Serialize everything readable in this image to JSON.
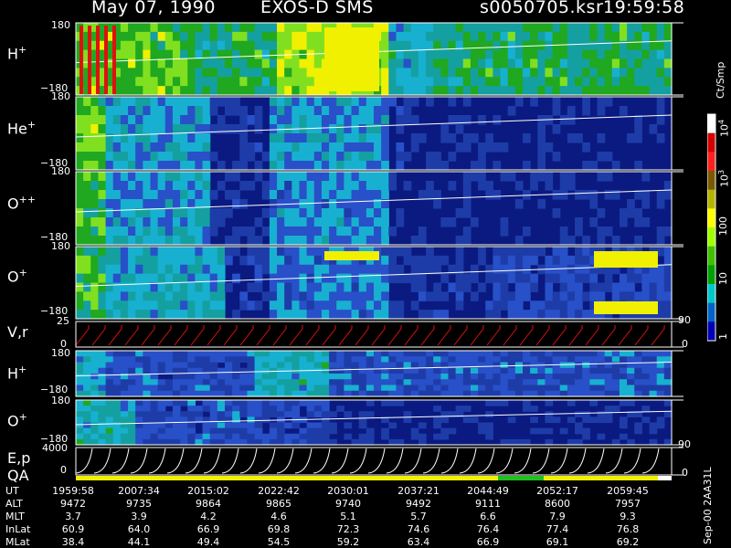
{
  "header": {
    "date": "May 07, 1990",
    "mission": "EXOS-D SMS",
    "file": "s0050705.ksr",
    "time": "19:59:58"
  },
  "colorbar": {
    "unit": "Ct/Smp",
    "ticks": [
      "10",
      "10",
      "100",
      "10",
      "1"
    ],
    "tick_exp": [
      "4",
      "3",
      "",
      "",
      ""
    ],
    "colors": [
      "#ffffff",
      "#d20000",
      "#ff2020",
      "#7a5a00",
      "#b4b400",
      "#ffff00",
      "#a0ff00",
      "#40c000",
      "#00a000",
      "#00c8c8",
      "#0064c8",
      "#0000b4"
    ]
  },
  "panels": [
    {
      "id": "h-plus",
      "label": "H",
      "sup": "+",
      "ymax": "180",
      "ymin": "−180"
    },
    {
      "id": "he-plus",
      "label": "He",
      "sup": "+",
      "ymax": "180",
      "ymin": "−180"
    },
    {
      "id": "o-plus-plus",
      "label": "O",
      "sup": "++",
      "ymax": "180",
      "ymin": "−180"
    },
    {
      "id": "o-plus",
      "label": "O",
      "sup": "+",
      "ymax": "180",
      "ymin": "−180"
    },
    {
      "id": "vr",
      "label": "V,r",
      "ymax": "25",
      "ymin": "0",
      "right_max": "90",
      "right_min": "0"
    },
    {
      "id": "h-plus-2",
      "label": "H",
      "sup": "+",
      "ymax": "180",
      "ymin": "−180"
    },
    {
      "id": "o-plus-2",
      "label": "O",
      "sup": "+",
      "ymax": "180",
      "ymin": "−180"
    },
    {
      "id": "ep",
      "label": "E,p",
      "ymax": "4000",
      "ymin": "0",
      "right_max": "90",
      "right_min": "0"
    },
    {
      "id": "qa",
      "label": "QA"
    }
  ],
  "table": {
    "rows": [
      {
        "name": "UT",
        "values": [
          "1959:58",
          "2007:34",
          "2015:02",
          "2022:42",
          "2030:01",
          "2037:21",
          "2044:49",
          "2052:17",
          "2059:45"
        ]
      },
      {
        "name": "ALT",
        "values": [
          "9472",
          "9735",
          "9864",
          "9865",
          "9740",
          "9492",
          "9111",
          "8600",
          "7957"
        ]
      },
      {
        "name": "MLT",
        "values": [
          "3.7",
          "3.9",
          "4.2",
          "4.6",
          "5.1",
          "5.7",
          "6.6",
          "7.9",
          "9.3"
        ]
      },
      {
        "name": "InLat",
        "values": [
          "60.9",
          "64.0",
          "66.9",
          "69.8",
          "72.3",
          "74.6",
          "76.4",
          "77.4",
          "76.8"
        ]
      },
      {
        "name": "MLat",
        "values": [
          "38.4",
          "44.1",
          "49.4",
          "54.5",
          "59.2",
          "63.4",
          "66.9",
          "69.1",
          "69.2"
        ]
      }
    ]
  },
  "footer": {
    "stamp": "Sep-00  2AA31L"
  },
  "chart_data": {
    "type": "heatmap",
    "title": "May 07, 1990   EXOS-D SMS",
    "xlabel": "UT",
    "x": [
      "1959:58",
      "2007:34",
      "2015:02",
      "2022:42",
      "2030:01",
      "2037:21",
      "2044:49",
      "2052:17",
      "2059:45"
    ],
    "series": [
      {
        "name": "H+",
        "yrange": [
          -180,
          180
        ]
      },
      {
        "name": "He+",
        "yrange": [
          -180,
          180
        ]
      },
      {
        "name": "O++",
        "yrange": [
          -180,
          180
        ]
      },
      {
        "name": "O+",
        "yrange": [
          -180,
          180
        ]
      },
      {
        "name": "V,r",
        "yrange": [
          0,
          25
        ],
        "right_range": [
          0,
          90
        ]
      },
      {
        "name": "H+",
        "yrange": [
          -180,
          180
        ]
      },
      {
        "name": "O+",
        "yrange": [
          -180,
          180
        ]
      },
      {
        "name": "E,p",
        "yrange": [
          0,
          4000
        ],
        "right_range": [
          0,
          90
        ]
      },
      {
        "name": "QA"
      }
    ],
    "colorbar_unit": "Ct/Smp",
    "colorbar_range": [
      1,
      10000
    ]
  }
}
